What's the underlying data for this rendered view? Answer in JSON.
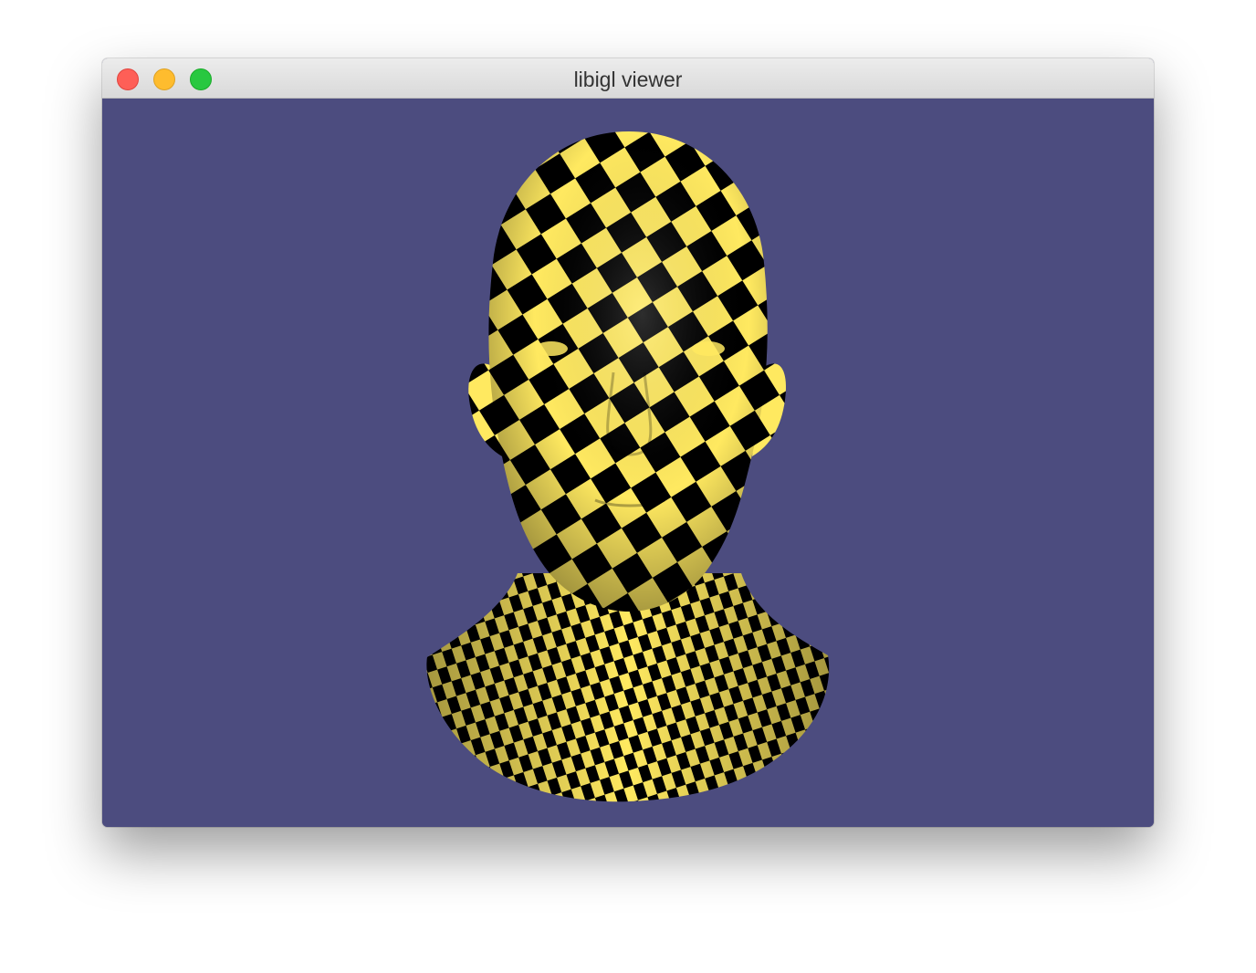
{
  "window": {
    "title": "libigl viewer",
    "controls": [
      {
        "name": "close-button",
        "color": "#fe5f57"
      },
      {
        "name": "minimize-button",
        "color": "#febc2e"
      },
      {
        "name": "zoom-button",
        "color": "#28c840"
      }
    ]
  },
  "viewport": {
    "background_color": "#4c4c7f",
    "mesh_colors": [
      "#ffe960",
      "#000000"
    ]
  }
}
